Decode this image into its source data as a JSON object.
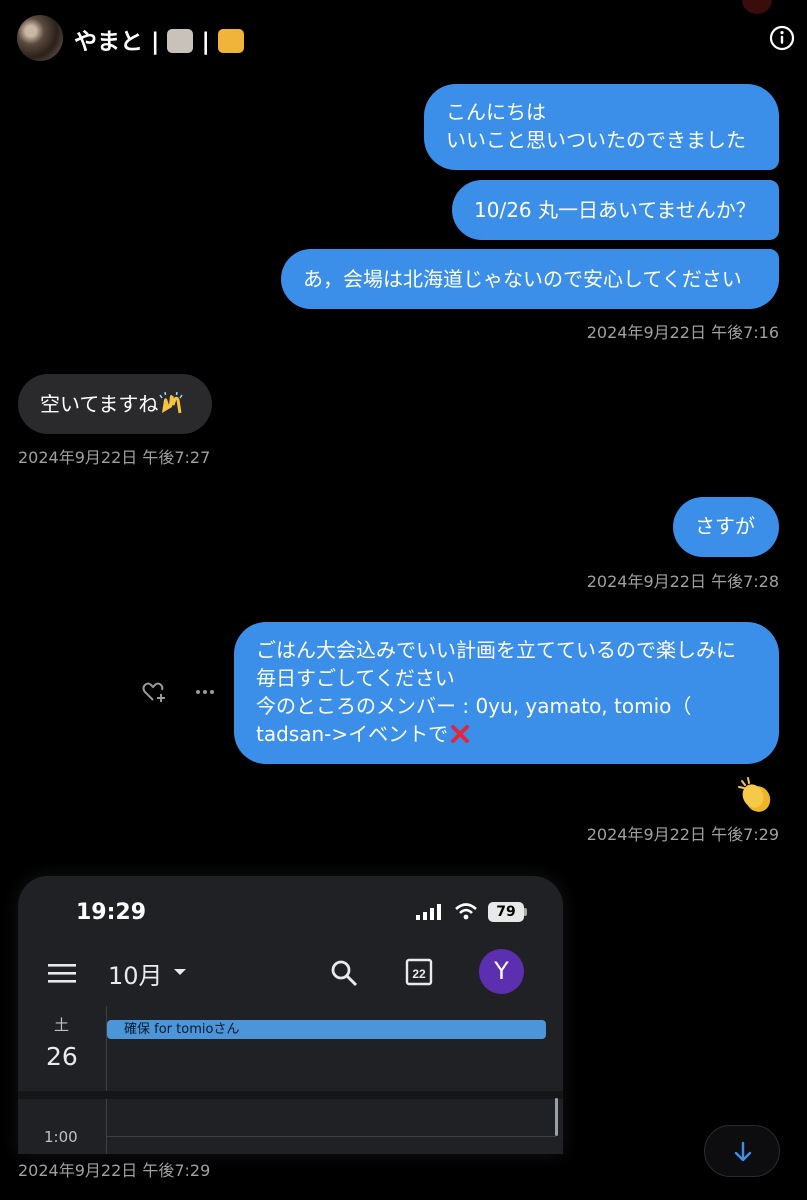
{
  "header": {
    "title": "やまと | ☕ | 🐈",
    "title_text_1": "やまと |",
    "title_text_2": "|",
    "emoji_coffee": "☕",
    "emoji_cat": "🐈"
  },
  "messages": {
    "out1_line1": "こんにちは",
    "out1_line2": "いいこと思いついたのできました",
    "out2": "10/26 丸一日あいてませんか？",
    "out3": "あ，会場は北海道じゃないので安心してください",
    "ts1": "2024年9月22日 午後7:16",
    "in1_text": "空いてますね",
    "in1_emoji": "🙌",
    "ts2": "2024年9月22日 午後7:27",
    "out4": "さすが",
    "ts3": "2024年9月22日 午後7:28",
    "out5_line1": "ごはん大会込みでいい計画を立てているので楽しみに",
    "out5_line2": "毎日すごしてください",
    "out5_line3": "今のところのメンバー : 0yu, yamato, tomio（",
    "out5_line4": "tadsan->イベントで",
    "out5_emoji": "❌",
    "reaction_emoji": "👏",
    "ts4": "2024年9月22日 午後7:29",
    "ts5": "2024年9月22日 午後7:29"
  },
  "screenshot": {
    "time": "19:29",
    "battery": "79",
    "month": "10月",
    "today_num": "22",
    "account_initial": "Y",
    "day_name": "土",
    "day_num": "26",
    "event": "確保 for tomioさん",
    "hour": "1:00"
  },
  "colors": {
    "outgoing_bubble": "#3b8fe8",
    "incoming_bubble": "#2a2a2c",
    "background": "#000000",
    "timestamp": "#a0a0a0",
    "account_avatar": "#5b2fb0",
    "event": "#4c95d9"
  },
  "icons": [
    "info-icon",
    "heart-add-icon",
    "more-icon",
    "arrow-down-icon",
    "menu-icon",
    "search-icon",
    "calendar-today-icon",
    "signal-icon",
    "wifi-icon"
  ]
}
